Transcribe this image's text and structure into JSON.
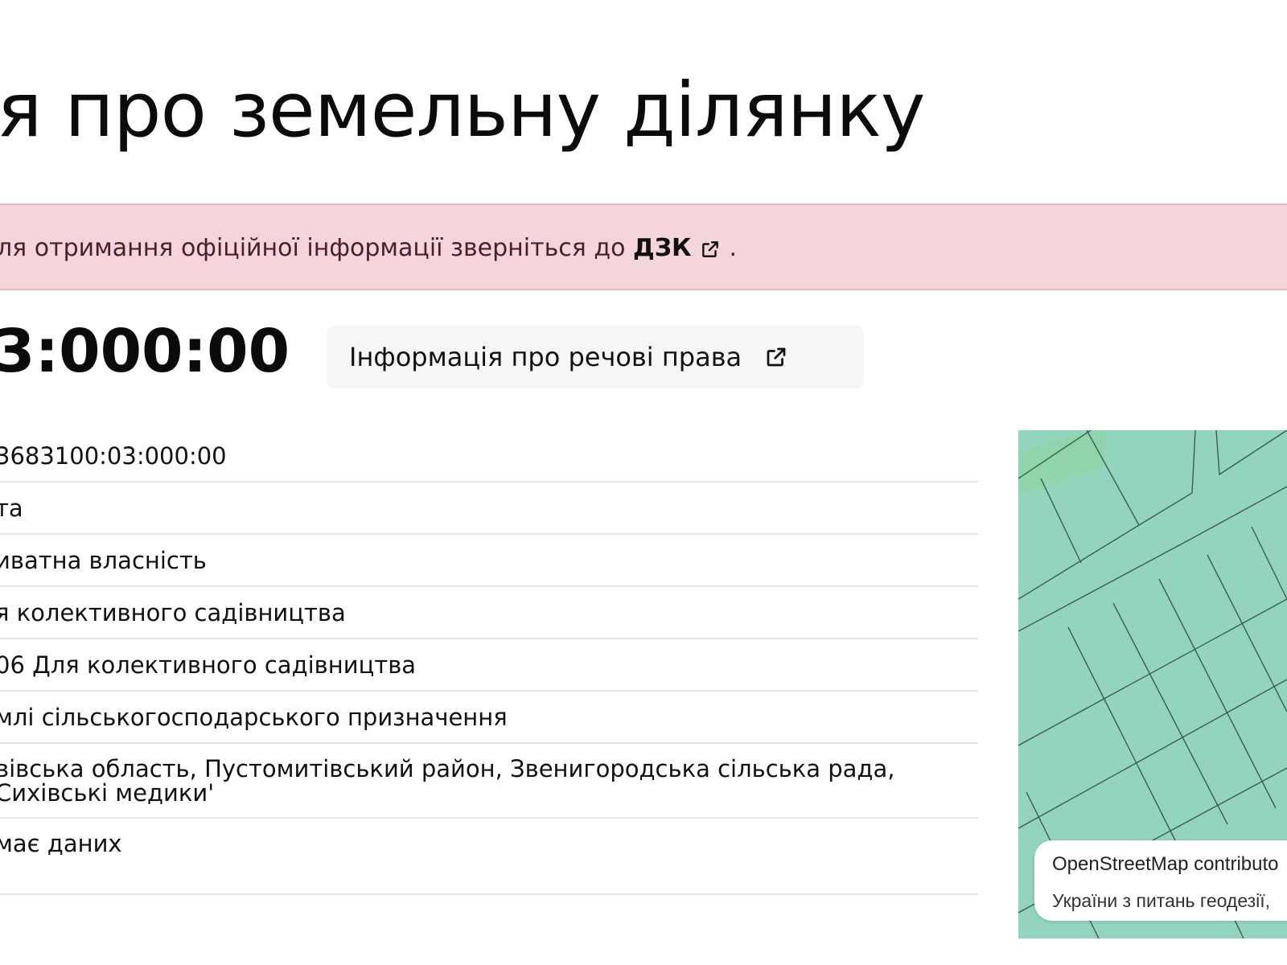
{
  "page": {
    "title": "я про земельну ділянку"
  },
  "alert": {
    "text": "ля отримання офіційної інформації зверніться до",
    "link_label": "ДЗК",
    "suffix": "."
  },
  "parcel": {
    "cadastral_number": "3:000:00",
    "rights_button_label": "Інформація про речові права"
  },
  "details": {
    "rows": [
      {
        "value": "3683100:03:000:00"
      },
      {
        "value": "та"
      },
      {
        "value": "иватна власність"
      },
      {
        "value": "я колективного садівництва"
      },
      {
        "value": "06 Для колективного садівництва"
      },
      {
        "value": "млі сільськогосподарського призначення"
      },
      {
        "value": "вівська область, Пустомитівський район, Звенигородська сільська рада,",
        "value_line2": "Сихівські медики'"
      },
      {
        "value": "має даних"
      }
    ]
  },
  "map": {
    "attribution_line1": "OpenStreetMap contributo",
    "attribution_line2": "України з питань геодезії,"
  },
  "colors": {
    "alert_bg": "#f3d5da",
    "map_fill": "#93d4bd",
    "button_bg": "#f4f6f8"
  }
}
